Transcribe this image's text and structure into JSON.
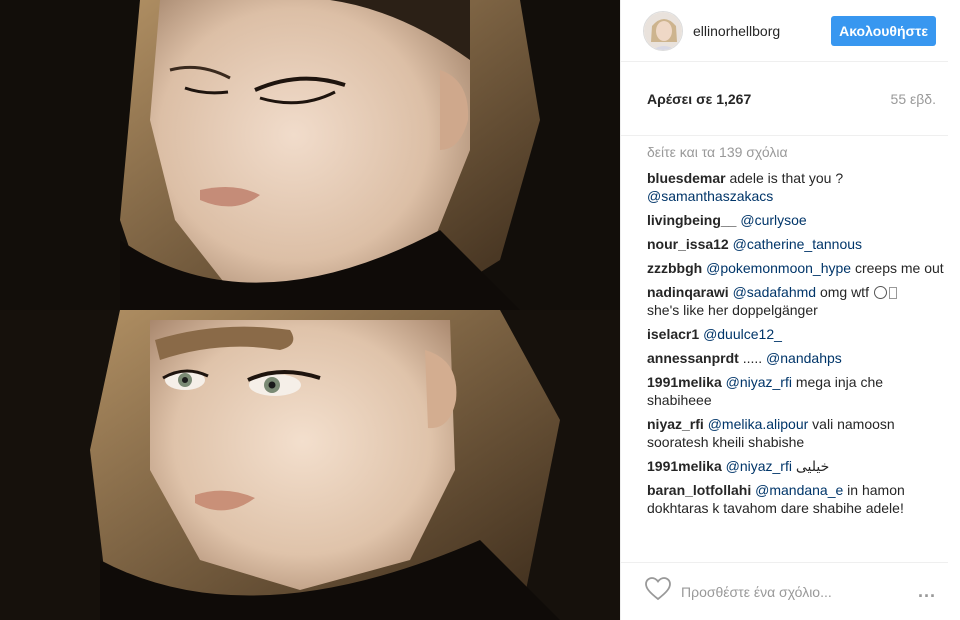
{
  "header": {
    "username": "ellinorhellborg",
    "follow_label": "Ακολουθήστε"
  },
  "stats": {
    "likes": "Αρέσει σε 1,267",
    "time": "55 εβδ."
  },
  "comments": {
    "load_more": "δείτε και τα 139 σχόλια",
    "items": [
      {
        "user": "bluesdemar",
        "parts": [
          " adele is that you ? ",
          "@samanthaszakacs",
          ""
        ]
      },
      {
        "user": "livingbeing__",
        "parts": [
          " ",
          "@curlysoe",
          ""
        ]
      },
      {
        "user": "nour_issa12",
        "parts": [
          " ",
          "@catherine_tannous",
          ""
        ]
      },
      {
        "user": "zzzbbgh",
        "parts": [
          " ",
          "@pokemonmoon_hype",
          " creeps me out"
        ]
      },
      {
        "user": "nadinqarawi",
        "parts": [
          " ",
          "@sadafahmd",
          " omg wtf "
        ],
        "tail": " she's like her doppelgänger"
      },
      {
        "user": "iselacr1",
        "parts": [
          " ",
          "@duulce12_",
          ""
        ]
      },
      {
        "user": "annessanprdt",
        "parts": [
          " ..... ",
          "@nandahps",
          ""
        ]
      },
      {
        "user": "1991melika",
        "parts": [
          " ",
          "@niyaz_rfi",
          " mega inja che shabiheee"
        ]
      },
      {
        "user": "niyaz_rfi",
        "parts": [
          " ",
          "@melika.alipour",
          " vali namoosn sooratesh kheili shabishe"
        ]
      },
      {
        "user": "1991melika",
        "parts": [
          " ",
          "@niyaz_rfi",
          " خیلیی"
        ]
      },
      {
        "user": "baran_lotfollahi",
        "parts": [
          " ",
          "@mandana_e",
          " in hamon dokhtaras k tavahom dare shabihe adele!"
        ]
      }
    ]
  },
  "add_comment": {
    "placeholder": "Προσθέστε ένα σχόλιο...",
    "more": "..."
  },
  "icons": {
    "heart": "heart-icon",
    "more": "more-options-icon",
    "emoji": "slightly-smiling-face-emoji"
  },
  "colors": {
    "follow_button": "#3897f0",
    "mention": "#003569",
    "muted": "#999999"
  }
}
